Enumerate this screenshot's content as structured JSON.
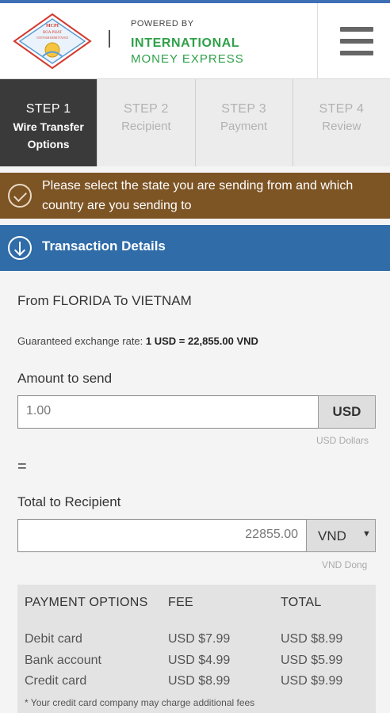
{
  "header": {
    "logo_text": "MCPI BOA PHAT VIETNAM REMITTANCE",
    "powered_by": "POWERED BY",
    "brand_line1": "INTERNATIONAL",
    "brand_line2": "MONEY EXPRESS",
    "menu_icon": "hamburger-menu-icon"
  },
  "steps": [
    {
      "num": "STEP 1",
      "label": "Wire Transfer Options",
      "active": true
    },
    {
      "num": "STEP 2",
      "label": "Recipient",
      "active": false
    },
    {
      "num": "STEP 3",
      "label": "Payment",
      "active": false
    },
    {
      "num": "STEP 4",
      "label": "Review",
      "active": false
    }
  ],
  "notice": {
    "icon": "check-circle-icon",
    "text": "Please select the state you are sending from and which country are you sending to"
  },
  "section": {
    "icon": "arrow-down-circle-icon",
    "title": "Transaction Details"
  },
  "transaction": {
    "route": "From FLORIDA To VIETNAM",
    "rate_label": "Guaranteed exchange rate:",
    "rate_value": "1 USD = 22,855.00 VND",
    "amount_label": "Amount to send",
    "amount_value": "1.00",
    "amount_currency": "USD",
    "amount_hint": "USD Dollars",
    "equals": "=",
    "total_label": "Total to Recipient",
    "total_value": "22855.00",
    "total_currency": "VND",
    "total_hint": "VND Dong"
  },
  "payment_options": {
    "headers": [
      "PAYMENT OPTIONS",
      "FEE",
      "TOTAL"
    ],
    "rows": [
      [
        "Debit card",
        "USD $7.99",
        "USD $8.99"
      ],
      [
        "Bank account",
        "USD $4.99",
        "USD $5.99"
      ],
      [
        "Credit card",
        "USD $8.99",
        "USD $9.99"
      ]
    ],
    "note": "* Your credit card company may charge additional fees"
  },
  "colors": {
    "accent_blue": "#2f6ca8",
    "notice_brown": "#7d5424",
    "brand_green": "#2fa14a",
    "active_step": "#3a3a3a"
  }
}
